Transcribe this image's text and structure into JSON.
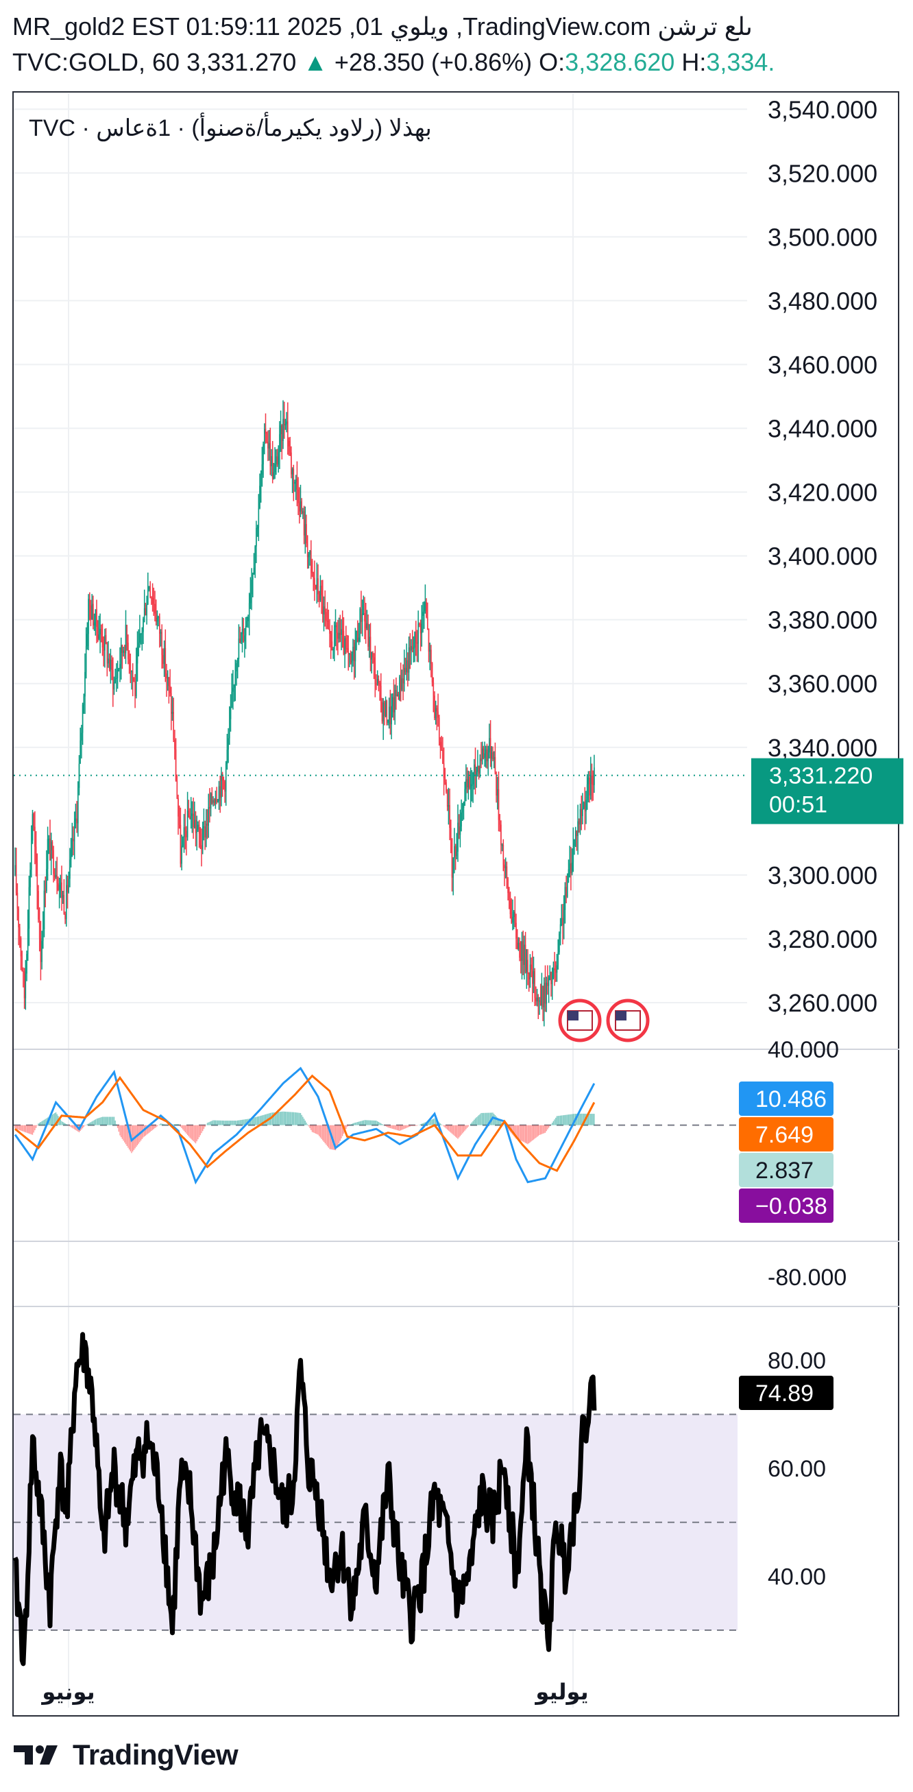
{
  "header": {
    "line1": "MR_gold2 EST 01:59:11 2025 ,01 ويلوي ,TradingView.com ىلع ترشن",
    "symbol": "TVC:GOLD, 60",
    "last": "3,331.270",
    "change": "+28.350 (+0.86%)",
    "open_label": "O:",
    "open_value": "3,328.620",
    "high_label": "H:",
    "high_value": "3,334."
  },
  "legend": "TVC · بهذلا (رلاود يكيرمأ/ةصنوأ) · 1ةعاس",
  "colors": {
    "up": "#089981",
    "down": "#f23645",
    "price_tag": "#089981",
    "macd_line": "#2196f3",
    "signal_line": "#ff6d00",
    "rsi_line": "#000000",
    "rsi_band": "#ede9f7",
    "hist_badge": "#b2dfdb",
    "purple_badge": "#880e9e"
  },
  "chart_data": [
    {
      "type": "candlestick",
      "title": "TVC · بهذلا (رلاود يكيرمأ/ةصنوأ) · 1ةعاس",
      "ylim": [
        3240,
        3545
      ],
      "y_ticks": [
        "3,260.000",
        "3,280.000",
        "3,300.000",
        "3,340.000",
        "3,360.000",
        "3,380.000",
        "3,400.000",
        "3,420.000",
        "3,440.000",
        "3,460.000",
        "3,480.000",
        "3,500.000",
        "3,520.000",
        "3,540.000"
      ],
      "y_tick_values": [
        3260,
        3280,
        3300,
        3340,
        3360,
        3380,
        3400,
        3420,
        3440,
        3460,
        3480,
        3500,
        3520,
        3540
      ],
      "x_labels": [
        "يونيو",
        "يوليو"
      ],
      "last_price": 3331.22,
      "last_price_label": "3,331.220",
      "countdown": "00:51",
      "events": [
        "us-flag-icon",
        "us-flag-icon"
      ],
      "anchors_idx": [
        0,
        8,
        15,
        22,
        28,
        35,
        43,
        53,
        63,
        77,
        85,
        95,
        103,
        105,
        115,
        125,
        135,
        142,
        150,
        160,
        170,
        180,
        190,
        198,
        205,
        215,
        222,
        232,
        237,
        243,
        250,
        256,
        262,
        270,
        278,
        288,
        298,
        305,
        315,
        322,
        332,
        342,
        352,
        360,
        370,
        375,
        385,
        393,
        400,
        410,
        415,
        420,
        425,
        432,
        440,
        450,
        457,
        465,
        468,
        475,
        482,
        490,
        497
      ],
      "anchors_val": [
        3300,
        3262,
        3320,
        3275,
        3310,
        3302,
        3290,
        3320,
        3385,
        3372,
        3360,
        3375,
        3358,
        3368,
        3392,
        3375,
        3350,
        3306,
        3320,
        3310,
        3325,
        3330,
        3370,
        3378,
        3400,
        3440,
        3425,
        3445,
        3428,
        3420,
        3405,
        3392,
        3388,
        3372,
        3376,
        3365,
        3384,
        3370,
        3352,
        3350,
        3362,
        3372,
        3384,
        3352,
        3330,
        3302,
        3325,
        3330,
        3338,
        3340,
        3320,
        3302,
        3290,
        3278,
        3272,
        3260,
        3265,
        3270,
        3282,
        3300,
        3315,
        3325,
        3331
      ]
    },
    {
      "type": "line",
      "title": "MACD",
      "ylim": [
        -80,
        40
      ],
      "y_ticks": [
        "40.000",
        "-80.000"
      ],
      "y_tick_values": [
        40,
        -80
      ],
      "series": [
        {
          "anchors_idx": [
            0,
            15,
            35,
            55,
            70,
            85,
            100,
            125,
            140,
            155,
            170,
            190,
            210,
            230,
            245,
            260,
            275,
            290,
            310,
            330,
            345,
            360,
            380,
            395,
            410,
            420,
            430,
            440,
            455,
            470,
            485,
            497
          ],
          "anchors_val": [
            -5,
            -18,
            12,
            -2,
            15,
            28,
            -8,
            5,
            -3,
            -30,
            -15,
            -5,
            8,
            22,
            30,
            15,
            -12,
            -5,
            -2,
            -10,
            -5,
            6,
            -28,
            -10,
            4,
            2,
            -18,
            -30,
            -28,
            -10,
            8,
            22
          ]
        },
        {
          "anchors_idx": [
            0,
            20,
            40,
            60,
            75,
            90,
            110,
            130,
            150,
            165,
            180,
            200,
            220,
            240,
            255,
            270,
            285,
            300,
            320,
            340,
            360,
            380,
            400,
            420,
            435,
            450,
            465,
            480,
            497
          ],
          "anchors_val": [
            -2,
            -12,
            5,
            4,
            12,
            25,
            8,
            2,
            -10,
            -22,
            -14,
            -4,
            4,
            16,
            26,
            18,
            -6,
            -8,
            -4,
            -6,
            0,
            -16,
            -16,
            2,
            -10,
            -20,
            -24,
            -8,
            12
          ]
        }
      ],
      "value_labels": [
        "10.486",
        "7.649",
        "2.837",
        "−0.038"
      ]
    },
    {
      "type": "line",
      "title": "RSI",
      "ylim": [
        22,
        90
      ],
      "band": [
        30,
        70
      ],
      "midline": 50,
      "y_ticks": [
        "80.00",
        "60.00",
        "40.00"
      ],
      "y_tick_values": [
        80,
        60,
        40
      ],
      "last_label": "74.89",
      "anchors_idx": [
        0,
        8,
        15,
        22,
        30,
        38,
        45,
        52,
        60,
        68,
        75,
        85,
        95,
        105,
        115,
        125,
        135,
        142,
        150,
        160,
        170,
        180,
        190,
        200,
        210,
        220,
        230,
        238,
        245,
        252,
        260,
        270,
        280,
        290,
        300,
        310,
        320,
        330,
        340,
        350,
        360,
        370,
        380,
        390,
        400,
        410,
        420,
        430,
        440,
        450,
        457,
        465,
        472,
        480,
        490,
        497
      ],
      "anchors_val": [
        40,
        25,
        65,
        52,
        35,
        60,
        52,
        78,
        82,
        70,
        45,
        60,
        50,
        62,
        65,
        55,
        30,
        58,
        55,
        35,
        42,
        62,
        55,
        48,
        65,
        62,
        52,
        55,
        78,
        60,
        55,
        40,
        45,
        35,
        50,
        40,
        58,
        42,
        32,
        40,
        55,
        48,
        35,
        40,
        55,
        50,
        62,
        40,
        65,
        40,
        28,
        50,
        42,
        52,
        70,
        75
      ]
    }
  ]
}
